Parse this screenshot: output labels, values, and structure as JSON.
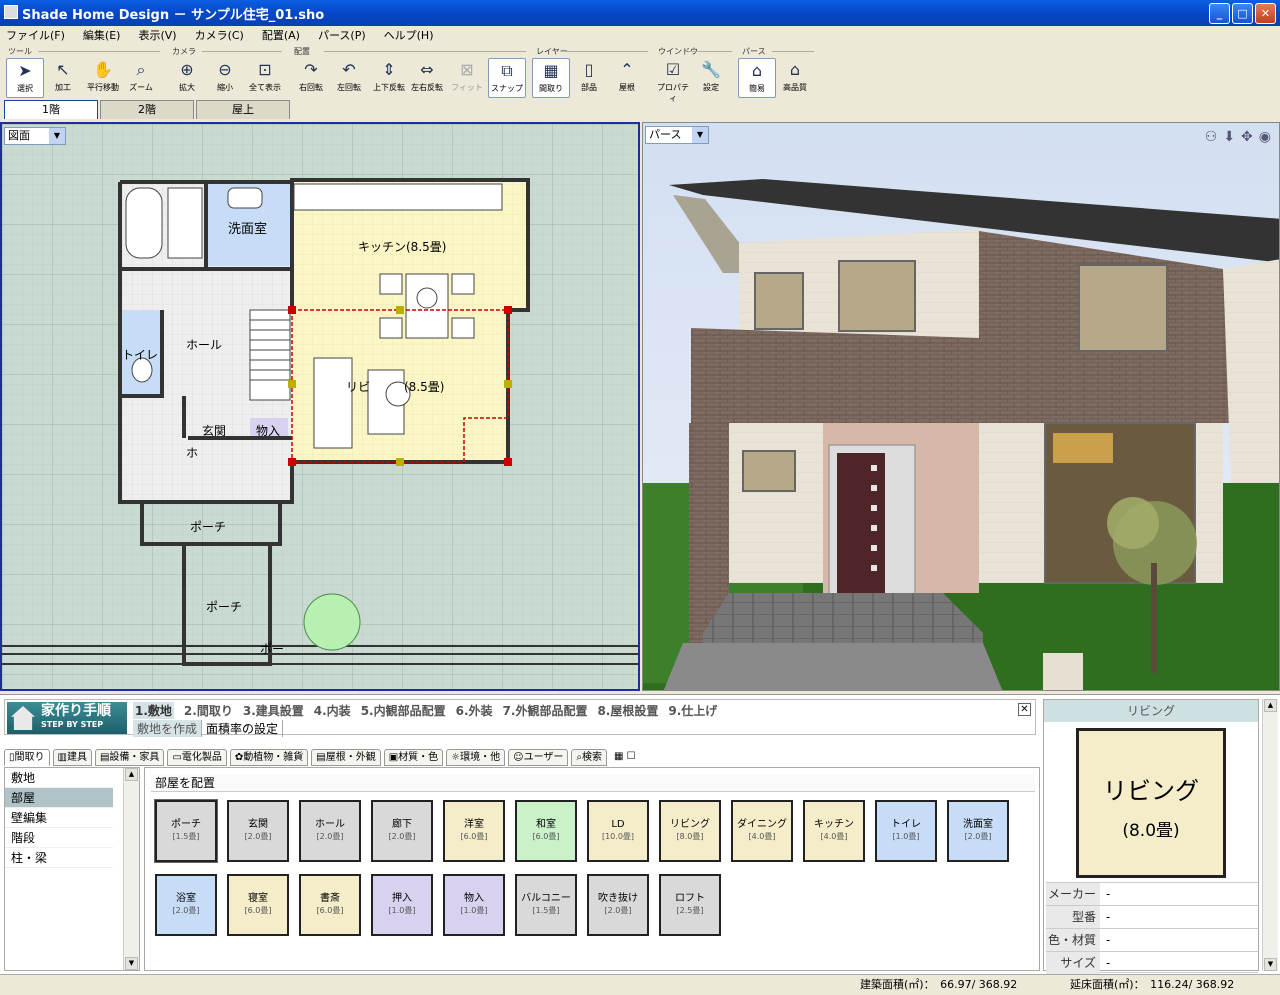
{
  "window": {
    "title": "Shade Home Design － サンプル住宅_01.sho",
    "buttons": {
      "min": "_",
      "max": "□",
      "close": "✕"
    }
  },
  "menu": [
    "ファイル(F)",
    "編集(E)",
    "表示(V)",
    "カメラ(C)",
    "配置(A)",
    "パース(P)",
    "ヘルプ(H)"
  ],
  "toolbar": {
    "groups": [
      "ツール",
      "カメラ",
      "配置",
      "レイヤー",
      "ウインドウ",
      "パース"
    ],
    "tools": [
      "選択",
      "加工",
      "平行移動",
      "ズーム",
      "拡大",
      "縮小",
      "全て表示",
      "右回転",
      "左回転",
      "上下反転",
      "左右反転",
      "フィット",
      "スナップ",
      "間取り",
      "部品",
      "屋根",
      "プロパティ",
      "設定",
      "簡易",
      "高品質"
    ]
  },
  "floor_tabs": [
    "1階",
    "2階",
    "屋上"
  ],
  "plan": {
    "view_select": "図面",
    "rooms": {
      "bath_label": "洗面室",
      "kitchen": "キッチン(8.5畳)",
      "hall": "ホール",
      "toilet": "トイレ",
      "living": "リビ",
      "living_size": "(8.5畳)",
      "entrance": "玄関",
      "storage": "物入",
      "entrance_ho": "ホ",
      "porch1": "ポーチ",
      "porch2": "ポーチ",
      "porch3": "ポー"
    }
  },
  "perspective": {
    "view_select": "パース"
  },
  "steps": {
    "logo_title": "家作り手順",
    "logo_sub": "STEP BY STEP",
    "items": [
      "1.敷地",
      "2.間取り",
      "3.建具設置",
      "4.内装",
      "5.内観部品配置",
      "6.外装",
      "7.外観部品配置",
      "8.屋根設置",
      "9.仕上げ"
    ],
    "sub": [
      "敷地を作成",
      "面積率の設定"
    ],
    "close": "✕"
  },
  "category_tabs": [
    "間取り",
    "建具",
    "設備・家具",
    "電化製品",
    "動植物・雑貨",
    "屋根・外観",
    "材質・色",
    "環境・他",
    "ユーザー",
    "検索"
  ],
  "categories": [
    "敷地",
    "部屋",
    "壁編集",
    "階段",
    "柱・梁"
  ],
  "gallery": {
    "title": "部屋を配置",
    "tiles": [
      {
        "name": "ポーチ",
        "size": "[1.5畳]",
        "color": "#d9d9d9"
      },
      {
        "name": "玄関",
        "size": "[2.0畳]",
        "color": "#d9d9d9"
      },
      {
        "name": "ホール",
        "size": "[2.0畳]",
        "color": "#d9d9d9"
      },
      {
        "name": "廊下",
        "size": "[2.0畳]",
        "color": "#d9d9d9"
      },
      {
        "name": "洋室",
        "size": "[6.0畳]",
        "color": "#f5edc9"
      },
      {
        "name": "和室",
        "size": "[6.0畳]",
        "color": "#c9f2c9"
      },
      {
        "name": "LD",
        "size": "[10.0畳]",
        "color": "#f5edc9"
      },
      {
        "name": "リビング",
        "size": "[8.0畳]",
        "color": "#f5edc9"
      },
      {
        "name": "ダイニング",
        "size": "[4.0畳]",
        "color": "#f5edc9"
      },
      {
        "name": "キッチン",
        "size": "[4.0畳]",
        "color": "#f5edc9"
      },
      {
        "name": "トイレ",
        "size": "[1.0畳]",
        "color": "#c6dcf7"
      },
      {
        "name": "洗面室",
        "size": "[2.0畳]",
        "color": "#c6dcf7"
      },
      {
        "name": "浴室",
        "size": "[2.0畳]",
        "color": "#c6dcf7"
      },
      {
        "name": "寝室",
        "size": "[6.0畳]",
        "color": "#f5edc9"
      },
      {
        "name": "書斎",
        "size": "[6.0畳]",
        "color": "#f5edc9"
      },
      {
        "name": "押入",
        "size": "[1.0畳]",
        "color": "#d8d2f0"
      },
      {
        "name": "物入",
        "size": "[1.0畳]",
        "color": "#d8d2f0"
      },
      {
        "name": "バルコニー",
        "size": "[1.5畳]",
        "color": "#d9d9d9"
      },
      {
        "name": "吹き抜け",
        "size": "[2.0畳]",
        "color": "#d9d9d9"
      },
      {
        "name": "ロフト",
        "size": "[2.5畳]",
        "color": "#d9d9d9"
      }
    ]
  },
  "properties": {
    "header": "リビング",
    "name": "リビング",
    "size": "(8.0畳)",
    "rows": [
      {
        "k": "メーカー",
        "v": "-"
      },
      {
        "k": "型番",
        "v": "-"
      },
      {
        "k": "色・材質",
        "v": "-"
      },
      {
        "k": "サイズ",
        "v": "-"
      }
    ]
  },
  "status": {
    "building_area": "建築面積(㎡)：　66.97/ 368.92",
    "floor_area": "延床面積(㎡)：　116.24/ 368.92"
  },
  "colors": {
    "titlebar": "#0548c8",
    "accent": "#1e3f9a",
    "plan_bg": "#c9dad1",
    "room_yellow": "#fbf6c6",
    "room_blue": "#c6dcf7"
  }
}
